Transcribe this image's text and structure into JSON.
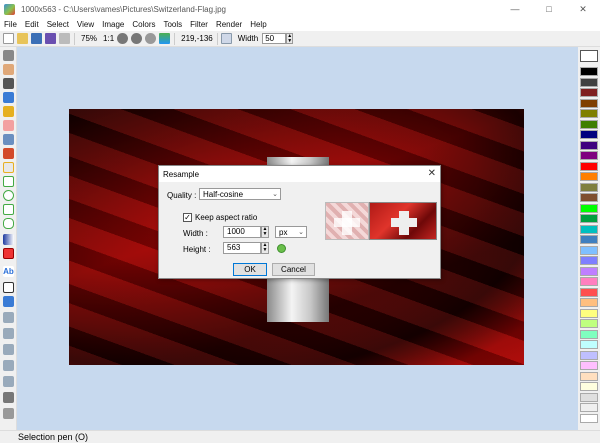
{
  "window": {
    "title": "1000x563 - C:\\Users\\vames\\Pictures\\Switzerland-Flag.jpg"
  },
  "menu": [
    "File",
    "Edit",
    "Select",
    "View",
    "Image",
    "Colors",
    "Tools",
    "Filter",
    "Render",
    "Help"
  ],
  "toolbar": {
    "zoom": "75%",
    "ratio": "1:1",
    "coords": "219,-136",
    "width_label": "Width",
    "width_value": "50"
  },
  "status": {
    "text": "Selection pen (O)"
  },
  "dialog": {
    "title": "Resample",
    "quality_label": "Quality :",
    "quality_value": "Half-cosine",
    "keep_aspect_label": "Keep aspect ratio",
    "keep_aspect_checked": true,
    "width_label": "Width :",
    "width_value": "1000",
    "unit_value": "px",
    "height_label": "Height :",
    "height_value": "563",
    "ok_label": "OK",
    "cancel_label": "Cancel"
  },
  "colors": {
    "canvas_bg": "#c7d9ee",
    "palette": [
      "#000000",
      "#404040",
      "#7f1f1f",
      "#7f3f00",
      "#7f7f00",
      "#3f7f00",
      "#00007f",
      "#3f007f",
      "#7f007f",
      "#ff0000",
      "#ff7f00",
      "#7f7f3f",
      "#7f4f2f",
      "#00ff00",
      "#009f3f",
      "#00bfbf",
      "#3f7fbf",
      "#7fbfff",
      "#7f7fff",
      "#bf7fff",
      "#ff7fbf",
      "#ff4f4f",
      "#ffbf7f",
      "#ffff7f",
      "#bfff7f",
      "#7fffbf",
      "#bfffff",
      "#bfbfff",
      "#ffbfff",
      "#ffdfbf",
      "#ffffdf",
      "#dfdfdf",
      "#efefef",
      "#ffffff"
    ]
  }
}
